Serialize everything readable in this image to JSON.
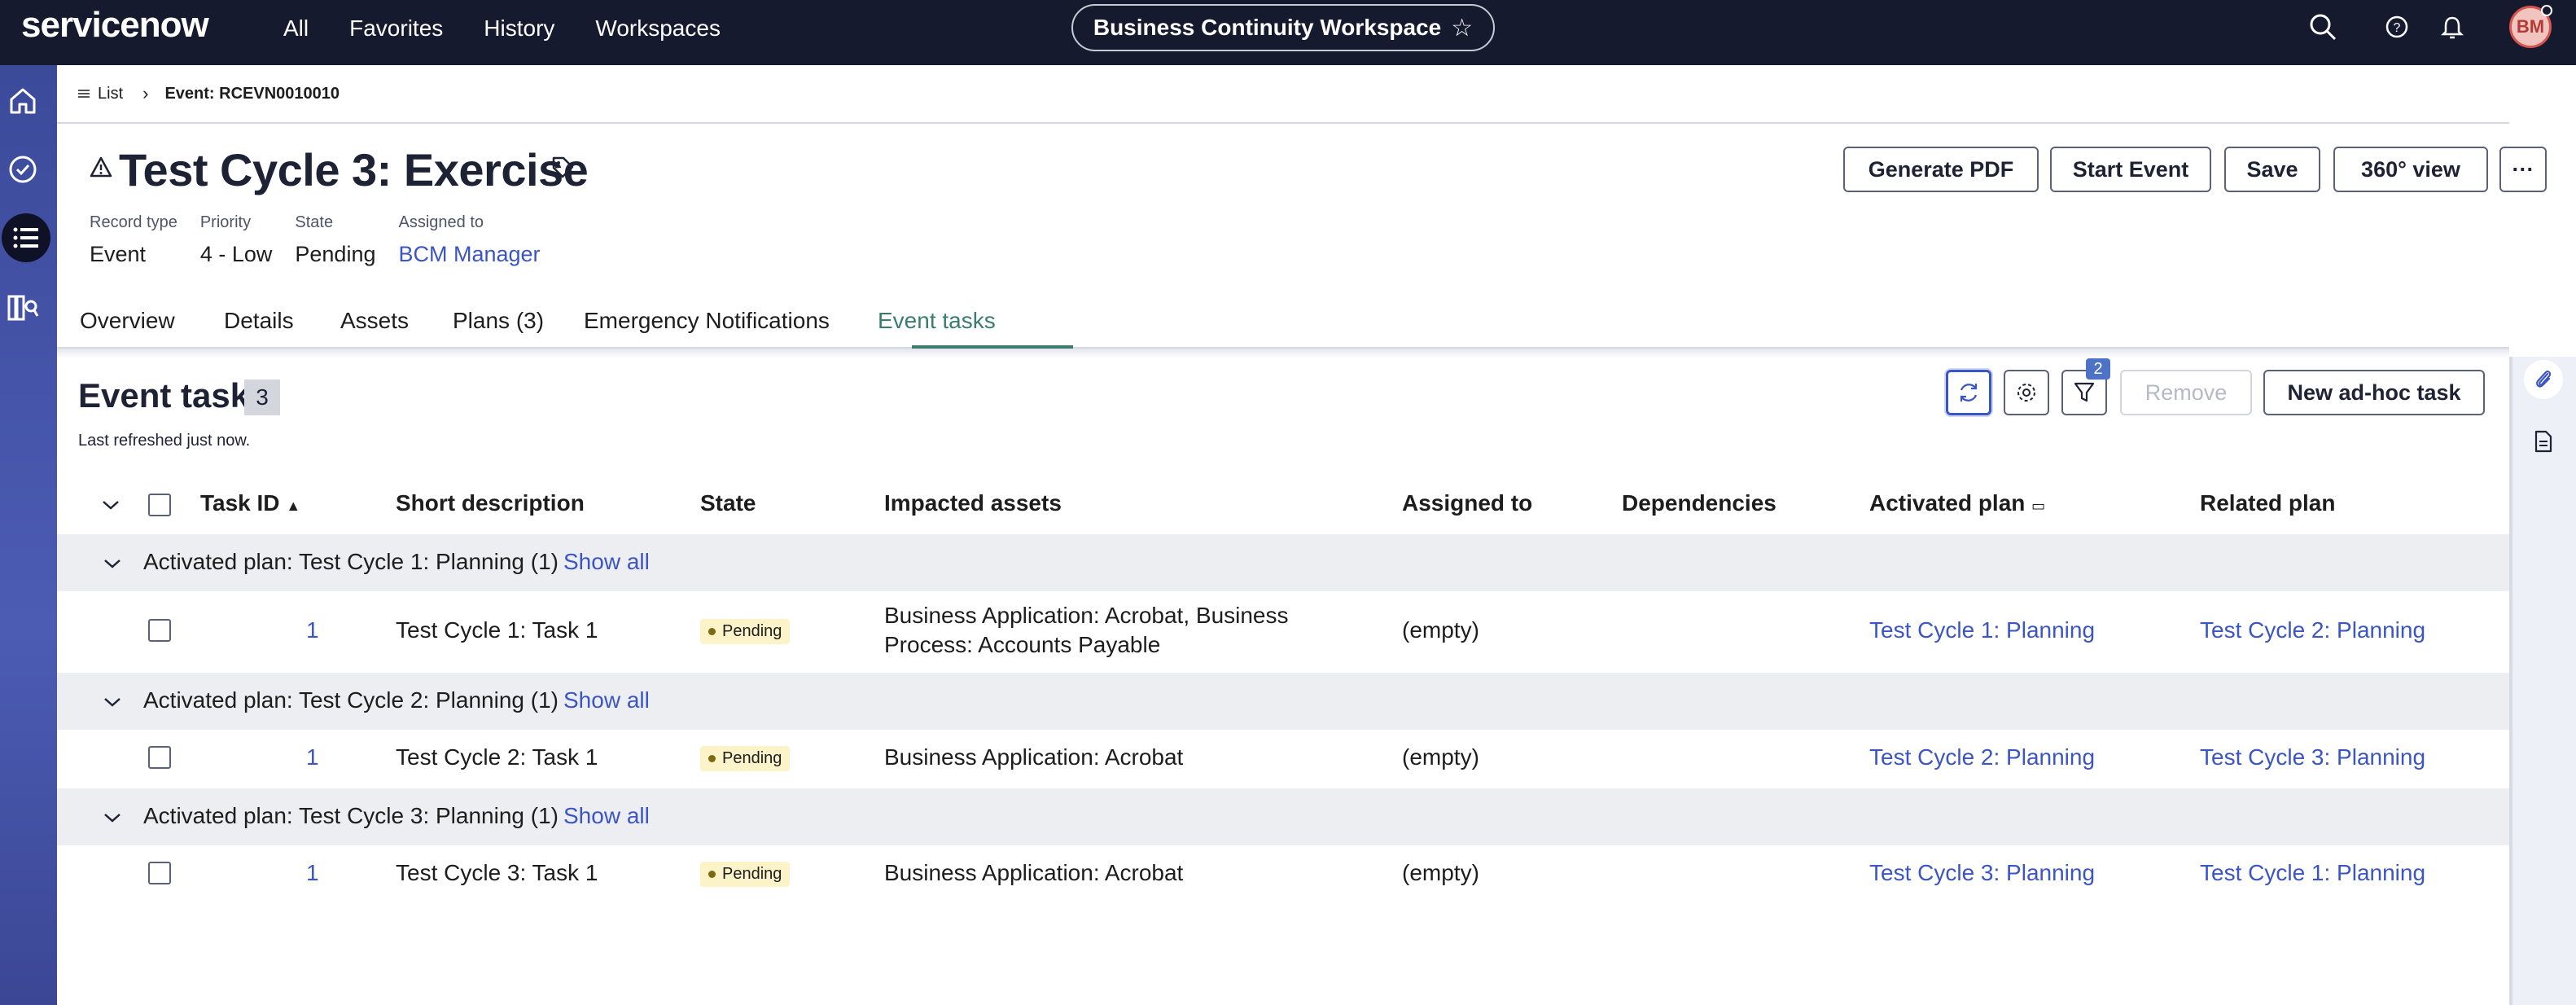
{
  "topbar": {
    "logo": "servicenow",
    "nav": [
      "All",
      "Favorites",
      "History",
      "Workspaces"
    ],
    "workspace": "Business Continuity Workspace",
    "avatar_initials": "BM"
  },
  "breadcrumb": {
    "list_label": "List",
    "current": "Event: RCEVN0010010"
  },
  "record": {
    "title": "Test Cycle 3: Exercise",
    "meta": [
      {
        "label": "Record type",
        "value": "Event"
      },
      {
        "label": "Priority",
        "value": "4 - Low"
      },
      {
        "label": "State",
        "value": "Pending"
      },
      {
        "label": "Assigned to",
        "value": "BCM Manager"
      }
    ]
  },
  "actions": {
    "generate_pdf": "Generate PDF",
    "start_event": "Start Event",
    "save": "Save",
    "view_360": "360° view",
    "more": "···"
  },
  "tabs": [
    "Overview",
    "Details",
    "Assets",
    "Plans (3)",
    "Emergency Notifications",
    "Event tasks"
  ],
  "active_tab": "Event tasks",
  "list": {
    "title": "Event task",
    "count": "3",
    "refreshed": "Last refreshed just now.",
    "filter_count": "2",
    "remove_label": "Remove",
    "new_task_label": "New ad-hoc task",
    "columns": [
      "Task ID",
      "Short description",
      "State",
      "Impacted assets",
      "Assigned to",
      "Dependencies",
      "Activated plan",
      "Related plan"
    ],
    "show_all": "Show all",
    "groups": [
      {
        "label": "Activated plan: Test Cycle 1: Planning (1)",
        "row": {
          "task_id": "1",
          "short_description": "Test Cycle 1: Task 1",
          "state": "Pending",
          "impacted_assets_line1": "Business Application: Acrobat, Business",
          "impacted_assets_line2": "Process: Accounts Payable",
          "assigned_to": "(empty)",
          "activated_plan": "Test Cycle 1: Planning",
          "related_plan": "Test Cycle 2: Planning"
        }
      },
      {
        "label": "Activated plan: Test Cycle 2: Planning (1)",
        "row": {
          "task_id": "1",
          "short_description": "Test Cycle 2: Task 1",
          "state": "Pending",
          "impacted_assets_line1": "Business Application: Acrobat",
          "impacted_assets_line2": "",
          "assigned_to": "(empty)",
          "activated_plan": "Test Cycle 2: Planning",
          "related_plan": "Test Cycle 3: Planning"
        }
      },
      {
        "label": "Activated plan: Test Cycle 3: Planning (1)",
        "row": {
          "task_id": "1",
          "short_description": "Test Cycle 3: Task 1",
          "state": "Pending",
          "impacted_assets_line1": "Business Application: Acrobat",
          "impacted_assets_line2": "",
          "assigned_to": "(empty)",
          "activated_plan": "Test Cycle 3: Planning",
          "related_plan": "Test Cycle 1: Planning"
        }
      }
    ]
  },
  "colors": {
    "topbar_bg": "#151a2e",
    "link": "#3b55c4",
    "active_tab": "#3c7c70",
    "pending_pill": "#fcf3c8"
  }
}
